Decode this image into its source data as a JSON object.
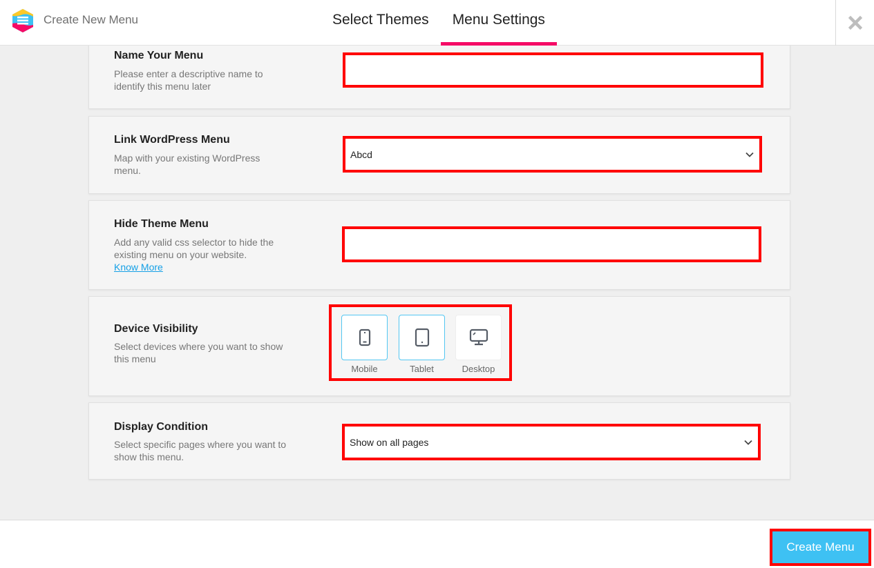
{
  "header": {
    "app_title": "Create New Menu",
    "tabs": [
      {
        "label": "Select Themes",
        "active": false
      },
      {
        "label": "Menu Settings",
        "active": true
      }
    ],
    "close_icon": "close-icon",
    "accent_color": "#f50b66"
  },
  "sections": {
    "name_menu": {
      "title": "Name Your Menu",
      "description": "Please enter a descriptive name to identify this menu later",
      "value": "",
      "placeholder": ""
    },
    "link_wp_menu": {
      "title": "Link WordPress Menu",
      "description": "Map with your existing WordPress menu.",
      "selected": "Abcd"
    },
    "hide_theme_menu": {
      "title": "Hide Theme Menu",
      "description": "Add any valid css selector to hide the existing menu on your website.",
      "link": "Know More",
      "value": "",
      "placeholder": ""
    },
    "device_visibility": {
      "title": "Device Visibility",
      "description": "Select devices where you want to show this menu",
      "devices": [
        {
          "label": "Mobile",
          "icon": "mobile-icon",
          "selected": true
        },
        {
          "label": "Tablet",
          "icon": "tablet-icon",
          "selected": true
        },
        {
          "label": "Desktop",
          "icon": "desktop-icon",
          "selected": false
        }
      ]
    },
    "display_condition": {
      "title": "Display Condition",
      "description": "Select specific pages where you want to show this menu.",
      "selected": "Show on all pages"
    }
  },
  "footer": {
    "create_label": "Create Menu",
    "button_color": "#3ec1f3"
  }
}
